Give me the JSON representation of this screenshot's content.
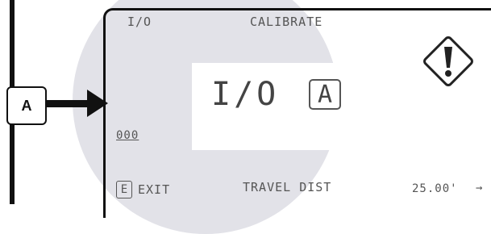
{
  "callout": {
    "label": "A"
  },
  "display": {
    "header_left": "I/O",
    "header_title": "CALIBRATE",
    "mode_text": "I/O",
    "mode_letter": "A",
    "counter": "000",
    "exit_key": "E",
    "exit_label": "EXIT",
    "param_label": "TRAVEL DIST",
    "param_value": "25.00'",
    "next_arrow": "→"
  },
  "icons": {
    "warning": "warning-diamond-icon"
  }
}
